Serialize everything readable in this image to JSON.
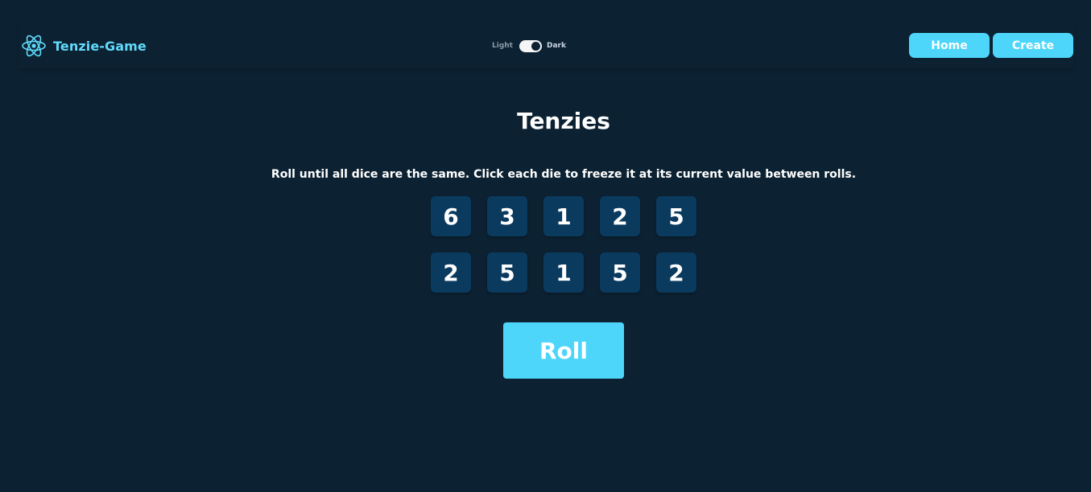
{
  "brand": {
    "name": "Tenzie-Game",
    "icon": "react-atom-icon",
    "color": "#61dafb"
  },
  "theme_toggle": {
    "light_label": "Light",
    "dark_label": "Dark",
    "selected": "Dark"
  },
  "nav": {
    "home_label": "Home",
    "create_label": "Create",
    "button_color": "#4dd6fa"
  },
  "game": {
    "title": "Tenzies",
    "instructions": "Roll until all dice are the same. Click each die to freeze it at its current value between rolls.",
    "dice": [
      "6",
      "3",
      "1",
      "2",
      "5",
      "2",
      "5",
      "1",
      "5",
      "2"
    ],
    "roll_label": "Roll"
  },
  "colors": {
    "background": "#0c2233",
    "die": "#0b3a5f",
    "accent": "#4dd6fa"
  }
}
